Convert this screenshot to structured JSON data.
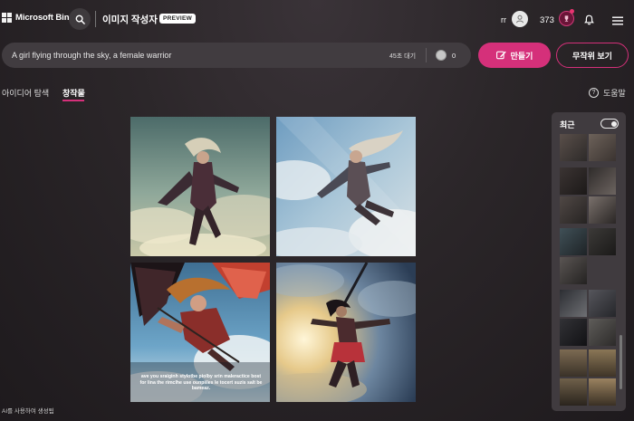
{
  "header": {
    "brand": "Microsoft Bing",
    "title": "이미지 작성자",
    "badge": "PREVIEW",
    "user_initials": "rr",
    "points": "373"
  },
  "prompt": {
    "text": "A girl flying through the sky, a female warrior",
    "wait": "45초 대기",
    "boost_count": "0"
  },
  "buttons": {
    "create": "만들기",
    "surprise": "무작위 보기"
  },
  "tabs": {
    "explore": "아이디어 탐색",
    "creations": "창작물"
  },
  "help": "도움말",
  "images": [
    {
      "alt": "girl flying warrior 1"
    },
    {
      "alt": "girl flying warrior 2"
    },
    {
      "alt": "girl flying warrior 3",
      "overlay_text": "ave you sraiginh stylotbe piolby srin maleractice bost for lina the rimclhe use ounpiiles le tocert suzis salt be bameaz."
    },
    {
      "alt": "girl flying warrior 4"
    }
  ],
  "ai_note": "AI를 사용하여 생성됨",
  "recent": {
    "title": "최근",
    "toggle_on": true
  },
  "colors": {
    "accent": "#d5307a",
    "background": "#2b2629",
    "panel": "#403b3f"
  },
  "icons": [
    "windows-logo-icon",
    "search-icon",
    "user-icon",
    "reward-trophy-icon",
    "bell-icon",
    "menu-icon",
    "create-brush-icon",
    "coin-icon",
    "help-icon"
  ]
}
